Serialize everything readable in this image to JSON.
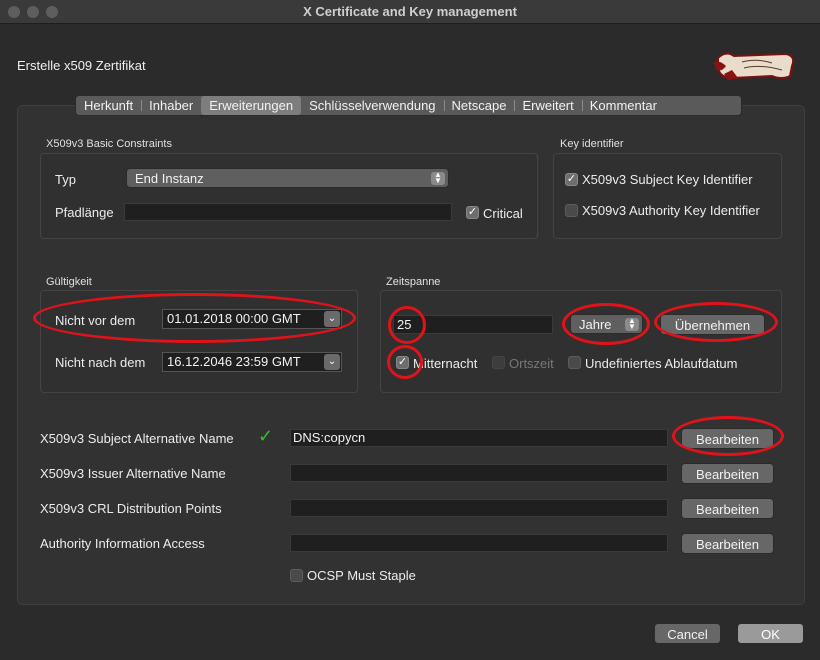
{
  "window": {
    "title": "X Certificate and Key management"
  },
  "heading": "Erstelle x509 Zertifikat",
  "tabs": [
    {
      "label": "Herkunft",
      "active": false
    },
    {
      "label": "Inhaber",
      "active": false
    },
    {
      "label": "Erweiterungen",
      "active": true
    },
    {
      "label": "Schlüsselverwendung",
      "active": false
    },
    {
      "label": "Netscape",
      "active": false
    },
    {
      "label": "Erweitert",
      "active": false
    },
    {
      "label": "Kommentar",
      "active": false
    }
  ],
  "basic_constraints": {
    "title": "X509v3 Basic Constraints",
    "typ_label": "Typ",
    "typ_value": "End Instanz",
    "pfadlaenge_label": "Pfadlänge",
    "pfadlaenge_value": "",
    "critical_label": "Critical",
    "critical_checked": true
  },
  "key_identifier": {
    "title": "Key identifier",
    "subject_label": "X509v3 Subject Key Identifier",
    "subject_checked": true,
    "authority_label": "X509v3 Authority Key Identifier",
    "authority_checked": false
  },
  "validity": {
    "title": "Gültigkeit",
    "not_before_label": "Nicht vor dem",
    "not_before_value": "01.01.2018 00:00 GMT",
    "not_after_label": "Nicht nach dem",
    "not_after_value": "16.12.2046 23:59 GMT"
  },
  "timespan": {
    "title": "Zeitspanne",
    "amount": "25",
    "unit": "Jahre",
    "apply_label": "Übernehmen",
    "midnight_label": "Mitternacht",
    "midnight_checked": true,
    "localtime_label": "Ortszeit",
    "localtime_checked": false,
    "undefined_label": "Undefiniertes Ablaufdatum",
    "undefined_checked": false
  },
  "extensions": [
    {
      "label": "X509v3 Subject Alternative Name",
      "value": "DNS:copycn",
      "button": "Bearbeiten",
      "valid": true
    },
    {
      "label": "X509v3 Issuer Alternative Name",
      "value": "",
      "button": "Bearbeiten",
      "valid": false
    },
    {
      "label": "X509v3 CRL Distribution Points",
      "value": "",
      "button": "Bearbeiten",
      "valid": false
    },
    {
      "label": "Authority Information Access",
      "value": "",
      "button": "Bearbeiten",
      "valid": false
    }
  ],
  "ocsp": {
    "label": "OCSP Must Staple",
    "checked": false
  },
  "footer": {
    "cancel_label": "Cancel",
    "ok_label": "OK"
  },
  "colors": {
    "annotation": "#e0131b",
    "valid_check": "#36c12b"
  }
}
